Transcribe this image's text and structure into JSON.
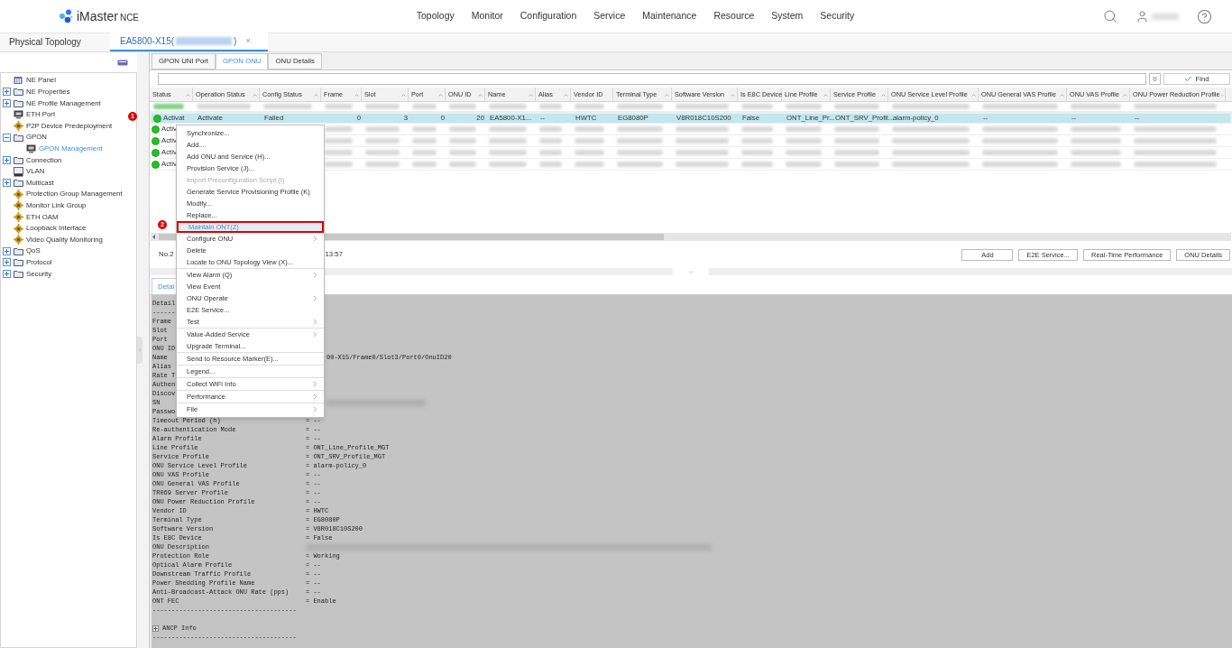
{
  "header": {
    "logo": {
      "name": "iMaster",
      "suffix": "NCE"
    },
    "nav": [
      "Topology",
      "Monitor",
      "Configuration",
      "Service",
      "Maintenance",
      "Resource",
      "System",
      "Security"
    ]
  },
  "tabs": [
    {
      "label": "Physical Topology",
      "selected": false
    },
    {
      "label": "EA5800-X15(",
      "label_end": ")",
      "close": "×",
      "selected": true
    }
  ],
  "tree": [
    {
      "label": "NE Panel",
      "kind": "panel",
      "selected": false
    },
    {
      "label": "NE Properties",
      "kind": "folder",
      "expanded": false,
      "selected": false
    },
    {
      "label": "NE Profile Management",
      "kind": "folder",
      "expanded": false,
      "selected": false
    },
    {
      "label": "ETH Port",
      "kind": "port",
      "selected": false
    },
    {
      "label": "P2P Device Predeployment",
      "kind": "gear",
      "selected": false
    },
    {
      "label": "GPON",
      "kind": "folder",
      "expanded": true,
      "selected": false,
      "children": [
        {
          "label": "GPON Management",
          "kind": "port",
          "selected": true
        }
      ]
    },
    {
      "label": "Connection",
      "kind": "folder",
      "expanded": false,
      "selected": false
    },
    {
      "label": "VLAN",
      "kind": "vlan",
      "selected": false
    },
    {
      "label": "Multicast",
      "kind": "folder",
      "expanded": false,
      "selected": false
    },
    {
      "label": "Protection Group Management",
      "kind": "gear",
      "selected": false
    },
    {
      "label": "Monitor Link Group",
      "kind": "gear",
      "selected": false
    },
    {
      "label": "ETH OAM",
      "kind": "gear",
      "selected": false
    },
    {
      "label": "Loopback Interface",
      "kind": "gear",
      "selected": false
    },
    {
      "label": "Video Quality Monitoring",
      "kind": "gear",
      "selected": false
    },
    {
      "label": "QoS",
      "kind": "folder",
      "expanded": false,
      "selected": false
    },
    {
      "label": "Protocol",
      "kind": "folder",
      "expanded": false,
      "selected": false
    },
    {
      "label": "Security",
      "kind": "folder",
      "expanded": false,
      "selected": false
    }
  ],
  "subtabs": [
    {
      "label": "GPON UNI Port",
      "selected": false
    },
    {
      "label": "GPON ONU",
      "selected": true
    },
    {
      "label": "ONU Details",
      "selected": false
    }
  ],
  "search": {
    "find_label": "Find"
  },
  "table": {
    "columns": [
      "Status",
      "Operation Status",
      "Config Status",
      "Frame",
      "Slot",
      "Port",
      "ONU ID",
      "Name",
      "Alias",
      "Vendor ID",
      "Terminal Type",
      "Software Version",
      "Is E8C Device",
      "Line Profile",
      "Service Profile",
      "ONU Service Level Profile",
      "ONU General VAS Profile",
      "ONU VAS Profile",
      "ONU Power Reduction Profile"
    ],
    "rows": [
      {
        "kind": "blurred",
        "selected": false
      },
      {
        "kind": "data",
        "selected": true,
        "annotated": true,
        "badge": "1",
        "cells": [
          "Activat",
          "Activate",
          "Failed",
          "0",
          "3",
          "0",
          "20",
          "EA5800-X1...",
          "--",
          "HWTC",
          "EG8080P",
          "V8R018C10S200",
          "False",
          "ONT_Line_Pr...",
          "ONT_SRV_Profil...",
          "alarm-policy_0",
          "--",
          "--",
          "--"
        ]
      },
      {
        "kind": "partial",
        "selected": false,
        "cells": [
          "Activ"
        ]
      },
      {
        "kind": "partial",
        "selected": false,
        "cells": [
          "Activ"
        ]
      },
      {
        "kind": "partial",
        "selected": false,
        "cells": [
          "Activ"
        ]
      },
      {
        "kind": "partial",
        "selected": false,
        "cells": [
          "Activ"
        ]
      }
    ]
  },
  "status": {
    "count": "No.2",
    "time": "13:57"
  },
  "actions": [
    "Add",
    "E2E Service...",
    "Real-Time Performance",
    "ONU Details"
  ],
  "detail_tab": {
    "label": "Detai",
    "selected": true
  },
  "detail_lines": [
    {
      "kind": "text",
      "label": "Detail"
    },
    {
      "kind": "text",
      "label": "------"
    },
    {
      "kind": "text",
      "label": "Frame"
    },
    {
      "kind": "text",
      "label": "Slot"
    },
    {
      "kind": "text",
      "label": "Port"
    },
    {
      "kind": "text",
      "label": "ONU ID"
    },
    {
      "kind": "covered",
      "label": "Name",
      "value": "00-X15/Frame0/Slot3/Port0/OnuID20"
    },
    {
      "kind": "text",
      "label": "Alias"
    },
    {
      "kind": "text",
      "label": "Rate T"
    },
    {
      "kind": "text",
      "label": "Authen"
    },
    {
      "kind": "text",
      "label": "Discov"
    },
    {
      "kind": "covered_blurred",
      "label": "SN"
    },
    {
      "kind": "text",
      "label": "Passwo"
    },
    {
      "kind": "pair",
      "label": "Timeout Period (h)",
      "value": "= --"
    },
    {
      "kind": "pair",
      "label": "Re-authentication Mode",
      "value": "= --"
    },
    {
      "kind": "pair",
      "label": "Alarm Profile",
      "value": "= --"
    },
    {
      "kind": "pair",
      "label": "Line Profile",
      "value": "= ONT_Line_Profile_MGT"
    },
    {
      "kind": "pair",
      "label": "Service Profile",
      "value": "= ONT_SRV_Profile_MGT"
    },
    {
      "kind": "pair",
      "label": "ONU Service Level Profile",
      "value": "= alarm-policy_0"
    },
    {
      "kind": "pair",
      "label": "ONU VAS Profile",
      "value": "= --"
    },
    {
      "kind": "pair",
      "label": "ONU General VAS Profile",
      "value": "= --"
    },
    {
      "kind": "pair",
      "label": "TR069 Server Profile",
      "value": "= --"
    },
    {
      "kind": "pair",
      "label": "ONU Power Reduction Profile",
      "value": "= --"
    },
    {
      "kind": "pair",
      "label": "Vendor ID",
      "value": "= HWTC"
    },
    {
      "kind": "pair",
      "label": "Terminal Type",
      "value": "= EG8080P"
    },
    {
      "kind": "pair",
      "label": "Software Version",
      "value": "= V8R018C10S200"
    },
    {
      "kind": "pair",
      "label": "Is E8C Device",
      "value": "= False"
    },
    {
      "kind": "blurred",
      "label": "ONU Description"
    },
    {
      "kind": "pair",
      "label": "Protection Role",
      "value": "= Working"
    },
    {
      "kind": "pair",
      "label": "Optical Alarm Profile",
      "value": "= --"
    },
    {
      "kind": "pair",
      "label": "Downstream Traffic Profile",
      "value": "= --"
    },
    {
      "kind": "pair",
      "label": "Power Shedding Profile Name",
      "value": "= --"
    },
    {
      "kind": "pair",
      "label": "Anti-Broadcast-Attack ONU Rate (pps)",
      "value": "= --"
    },
    {
      "kind": "pair",
      "label": "ONT FEC",
      "value": "= Enable"
    },
    {
      "kind": "text",
      "label": "--------------------------------------"
    },
    {
      "kind": "blank"
    },
    {
      "kind": "section",
      "label": "ANCP Info",
      "expanded": false
    },
    {
      "kind": "text",
      "label": "--------------------------------------"
    }
  ],
  "context_menu": {
    "items": [
      {
        "kind": "item",
        "label": "Synchronize...",
        "disabled": false,
        "submenu": false,
        "selected": false
      },
      {
        "kind": "item",
        "label": "Add...",
        "disabled": false,
        "submenu": false,
        "selected": false
      },
      {
        "kind": "item",
        "label": "Add ONU and Service (H)...",
        "disabled": false,
        "submenu": false,
        "selected": false
      },
      {
        "kind": "item",
        "label": "Provision Service (J)...",
        "disabled": false,
        "submenu": false,
        "selected": false
      },
      {
        "kind": "item",
        "label": "Import Preconfiguration Script (I)",
        "disabled": true,
        "submenu": false,
        "selected": false
      },
      {
        "kind": "item",
        "label": "Generate Service Provisioning Profile (K)",
        "disabled": false,
        "submenu": false,
        "selected": false
      },
      {
        "kind": "item",
        "label": "Modify...",
        "disabled": false,
        "submenu": false,
        "selected": false
      },
      {
        "kind": "item",
        "label": "Replace...",
        "disabled": false,
        "submenu": false,
        "selected": false
      },
      {
        "kind": "item",
        "label": "Maintain ONT(Z)",
        "disabled": false,
        "submenu": false,
        "selected": true,
        "annotated": true,
        "badge": "2"
      },
      {
        "kind": "item",
        "label": "Configure ONU",
        "disabled": false,
        "submenu": true,
        "selected": false
      },
      {
        "kind": "item",
        "label": "Delete",
        "disabled": false,
        "submenu": false,
        "selected": false
      },
      {
        "kind": "item",
        "label": "Locate to ONU Topology View (X)...",
        "disabled": false,
        "submenu": false,
        "selected": false
      },
      {
        "kind": "separator"
      },
      {
        "kind": "item",
        "label": "View Alarm (Q)",
        "disabled": false,
        "submenu": true,
        "selected": false
      },
      {
        "kind": "item",
        "label": "View Event",
        "disabled": false,
        "submenu": false,
        "selected": false
      },
      {
        "kind": "item",
        "label": "ONU Operate",
        "disabled": false,
        "submenu": true,
        "selected": false
      },
      {
        "kind": "item",
        "label": "E2E Service...",
        "disabled": false,
        "submenu": false,
        "selected": false
      },
      {
        "kind": "item",
        "label": "Test",
        "disabled": false,
        "submenu": true,
        "selected": false
      },
      {
        "kind": "separator"
      },
      {
        "kind": "item",
        "label": "Value-Added Service",
        "disabled": false,
        "submenu": true,
        "selected": false
      },
      {
        "kind": "item",
        "label": "Upgrade Terminal...",
        "disabled": false,
        "submenu": false,
        "selected": false
      },
      {
        "kind": "separator"
      },
      {
        "kind": "item",
        "label": "Send to Resource Marker(E)...",
        "disabled": false,
        "submenu": false,
        "selected": false
      },
      {
        "kind": "separator"
      },
      {
        "kind": "item",
        "label": "Legend...",
        "disabled": false,
        "submenu": false,
        "selected": false
      },
      {
        "kind": "separator"
      },
      {
        "kind": "item",
        "label": "Collect WiFi Info",
        "disabled": false,
        "submenu": true,
        "selected": false
      },
      {
        "kind": "separator"
      },
      {
        "kind": "item",
        "label": "Performance",
        "disabled": false,
        "submenu": true,
        "selected": false
      },
      {
        "kind": "separator"
      },
      {
        "kind": "item",
        "label": "File",
        "disabled": false,
        "submenu": true,
        "selected": false
      }
    ]
  }
}
